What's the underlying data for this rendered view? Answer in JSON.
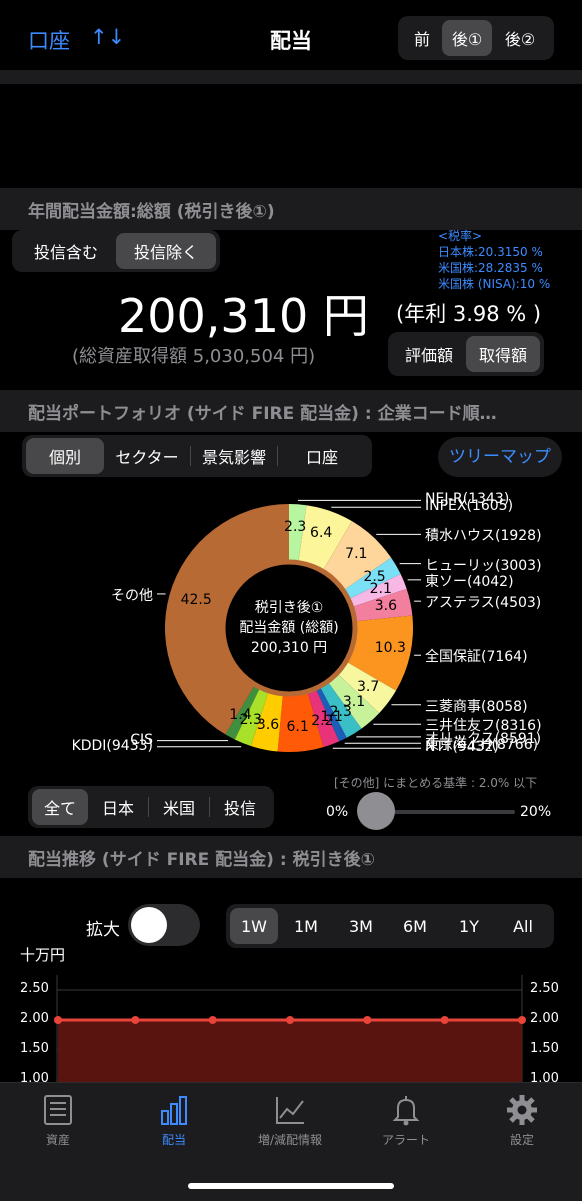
{
  "nav": {
    "account": "口座",
    "sort_icon": "↑↓",
    "title": "配当",
    "period_tabs": [
      "前",
      "後①",
      "後②"
    ],
    "period_selected": 1
  },
  "annual": {
    "header": "年間配当金額:総額 (税引き後①)",
    "toggle": [
      "投信含む",
      "投信除く"
    ],
    "toggle_selected": 1,
    "tax_title": "<税率>",
    "tax_lines": [
      "日本株:20.3150 %",
      "米国株:28.2835 %",
      "米国株 (NISA):10 %"
    ],
    "amount": "200,310 円",
    "yield": "(年利 3.98 % )",
    "asset_cost": "(総資産取得額 5,030,504 円)",
    "basis_toggle": [
      "評価額",
      "取得額"
    ],
    "basis_selected": 1
  },
  "portfolio": {
    "header": "配当ポートフォリオ (サイド FIRE 配当金) : 企業コード順…",
    "view_tabs": [
      "個別",
      "セクター",
      "景気影響",
      "口座"
    ],
    "view_selected": 0,
    "treemap_button": "ツリーマップ",
    "center_line1": "税引き後①",
    "center_line2": "配当金額 (総額)",
    "center_line3": "200,310 円",
    "filter_tabs": [
      "全て",
      "日本",
      "米国",
      "投信"
    ],
    "filter_selected": 0,
    "threshold_label": "[その他] にまとめる基準 : 2.0% 以下",
    "slider_min": "0%",
    "slider_max": "20%",
    "slider_value": 0.1
  },
  "chart_data": {
    "type": "pie",
    "donut": true,
    "slices": [
      {
        "label": "NEJ-R(1343)",
        "value": 2.3,
        "color": "#b8f5a0"
      },
      {
        "label": "INPEX(1605)",
        "value": 6.4,
        "color": "#fdf59a"
      },
      {
        "label": "積水ハウス(1928)",
        "value": 7.1,
        "color": "#fed59a"
      },
      {
        "label": "ヒューリッ(3003)",
        "value": 2.5,
        "color": "#7be0f5"
      },
      {
        "label": "東ソー(4042)",
        "value": 2.1,
        "color": "#f7b8e6"
      },
      {
        "label": "アステラス(4503)",
        "value": 3.6,
        "color": "#f27f9d"
      },
      {
        "label": "全国保証(7164)",
        "value": 10.3,
        "color": "#fc9520"
      },
      {
        "label": "三菱商事(8058)",
        "value": 3.7,
        "color": "#f7f7a0"
      },
      {
        "label": "三井住友フ(8316)",
        "value": 3.1,
        "color": "#c7f29a"
      },
      {
        "label": "オリックス(8591)",
        "value": 2.3,
        "color": "#3bbfc7"
      },
      {
        "label": "東京海上H(8766)",
        "value": 1.1,
        "color": "#1d5db8"
      },
      {
        "label": "NTT(9432)",
        "value": 2.2,
        "color": "#e8327a"
      },
      {
        "label": "",
        "value": 6.1,
        "color": "#ff5a08"
      },
      {
        "label": "",
        "value": 3.6,
        "color": "#ffcc00"
      },
      {
        "label": "KDDI(9433)",
        "value": 2.3,
        "color": "#a8e02a"
      },
      {
        "label": "CIS",
        "value": 1.4,
        "color": "#3f8f3f"
      },
      {
        "label": "その他",
        "value": 42.5,
        "color": "#b86a35"
      }
    ]
  },
  "trend": {
    "header": "配当推移 (サイド FIRE 配当金) : 税引き後①",
    "zoom_label": "拡大",
    "range_tabs": [
      "1W",
      "1M",
      "3M",
      "6M",
      "1Y",
      "All"
    ],
    "range_selected": 0,
    "unit": "十万円",
    "y_ticks": [
      "2.50",
      "2.00",
      "1.50",
      "1.00"
    ],
    "line_values": [
      2.0,
      2.0,
      2.0,
      2.0,
      2.0,
      2.0,
      2.0
    ]
  },
  "tabbar": {
    "items": [
      "資産",
      "配当",
      "増/減配情報",
      "アラート",
      "設定"
    ],
    "selected": 1
  },
  "colors": {
    "accent": "#3d8bff",
    "line": "#e8443a",
    "fill": "#5a1410"
  }
}
